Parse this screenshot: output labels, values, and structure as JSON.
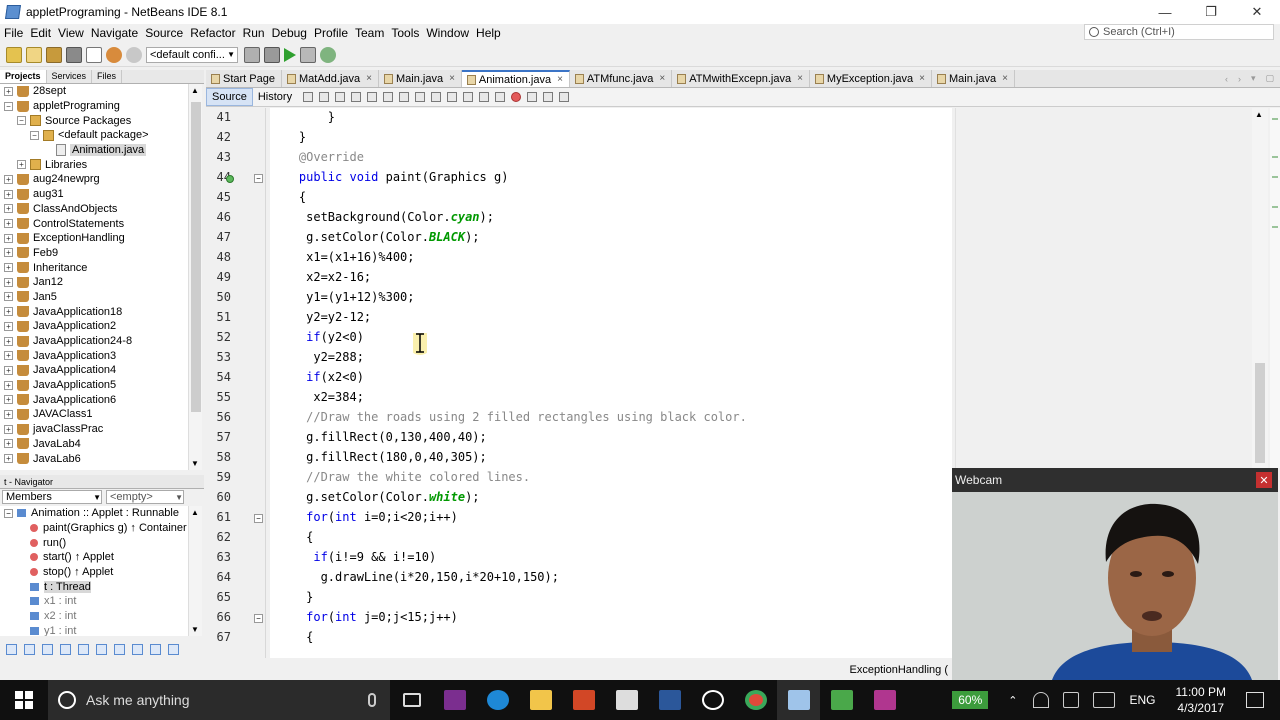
{
  "window": {
    "title": "appletPrograming - NetBeans IDE 8.1"
  },
  "menu": [
    "File",
    "Edit",
    "View",
    "Navigate",
    "Source",
    "Refactor",
    "Run",
    "Debug",
    "Profile",
    "Team",
    "Tools",
    "Window",
    "Help"
  ],
  "search": {
    "placeholder": "Search (Ctrl+I)"
  },
  "toolbar": {
    "config": "<default confi..."
  },
  "project_tabs": [
    "Projects",
    "Services",
    "Files"
  ],
  "projects": [
    {
      "label": "28sept",
      "level": 0,
      "type": "project"
    },
    {
      "label": "appletPrograming",
      "level": 0,
      "type": "project",
      "expanded": true
    },
    {
      "label": "Source Packages",
      "level": 1,
      "type": "pkgroot"
    },
    {
      "label": "<default package>",
      "level": 2,
      "type": "pkg"
    },
    {
      "label": "Animation.java",
      "level": 3,
      "type": "file",
      "selected": true
    },
    {
      "label": "Libraries",
      "level": 1,
      "type": "pkgroot"
    },
    {
      "label": "aug24newprg",
      "level": 0,
      "type": "project"
    },
    {
      "label": "aug31",
      "level": 0,
      "type": "project"
    },
    {
      "label": "ClassAndObjects",
      "level": 0,
      "type": "project"
    },
    {
      "label": "ControlStatements",
      "level": 0,
      "type": "project"
    },
    {
      "label": "ExceptionHandling",
      "level": 0,
      "type": "project"
    },
    {
      "label": "Feb9",
      "level": 0,
      "type": "project"
    },
    {
      "label": "Inheritance",
      "level": 0,
      "type": "project"
    },
    {
      "label": "Jan12",
      "level": 0,
      "type": "project"
    },
    {
      "label": "Jan5",
      "level": 0,
      "type": "project"
    },
    {
      "label": "JavaApplication18",
      "level": 0,
      "type": "project"
    },
    {
      "label": "JavaApplication2",
      "level": 0,
      "type": "project"
    },
    {
      "label": "JavaApplication24-8",
      "level": 0,
      "type": "project"
    },
    {
      "label": "JavaApplication3",
      "level": 0,
      "type": "project"
    },
    {
      "label": "JavaApplication4",
      "level": 0,
      "type": "project"
    },
    {
      "label": "JavaApplication5",
      "level": 0,
      "type": "project"
    },
    {
      "label": "JavaApplication6",
      "level": 0,
      "type": "project"
    },
    {
      "label": "JAVAClass1",
      "level": 0,
      "type": "project"
    },
    {
      "label": "javaClassPrac",
      "level": 0,
      "type": "project"
    },
    {
      "label": "JavaLab4",
      "level": 0,
      "type": "project"
    },
    {
      "label": "JavaLab6",
      "level": 0,
      "type": "project"
    }
  ],
  "navigator": {
    "title": "t - Navigator",
    "filter": "Members",
    "filter2": "<empty>",
    "items": [
      {
        "label": "Animation :: Applet : Runnable",
        "kind": "class"
      },
      {
        "label": "paint(Graphics g) ↑ Container",
        "kind": "method"
      },
      {
        "label": "run()",
        "kind": "method"
      },
      {
        "label": "start() ↑ Applet",
        "kind": "method"
      },
      {
        "label": "stop() ↑ Applet",
        "kind": "method"
      },
      {
        "label": "t : Thread",
        "kind": "field",
        "selected": true
      },
      {
        "label": "x1 : int",
        "kind": "field"
      },
      {
        "label": "x2 : int",
        "kind": "field"
      },
      {
        "label": "y1 : int",
        "kind": "field"
      }
    ]
  },
  "editor_tabs": [
    {
      "label": "Start Page",
      "active": false
    },
    {
      "label": "MatAdd.java",
      "active": false
    },
    {
      "label": "Main.java",
      "active": false
    },
    {
      "label": "Animation.java",
      "active": true
    },
    {
      "label": "ATMfunc.java",
      "active": false
    },
    {
      "label": "ATMwithExcepn.java",
      "active": false
    },
    {
      "label": "MyException.java",
      "active": false
    },
    {
      "label": "Main.java",
      "active": false
    }
  ],
  "editor_modes": [
    "Source",
    "History"
  ],
  "code_lines": [
    {
      "n": "41",
      "text": "        }"
    },
    {
      "n": "42",
      "text": "    }"
    },
    {
      "n": "43",
      "text": "    @Override"
    },
    {
      "n": "44",
      "text": "    public void paint(Graphics g)"
    },
    {
      "n": "45",
      "text": "    {"
    },
    {
      "n": "46",
      "text": "     setBackground(Color.cyan);"
    },
    {
      "n": "47",
      "text": "     g.setColor(Color.BLACK);"
    },
    {
      "n": "48",
      "text": "     x1=(x1+16)%400;"
    },
    {
      "n": "49",
      "text": "     x2=x2-16;"
    },
    {
      "n": "50",
      "text": "     y1=(y1+12)%300;"
    },
    {
      "n": "51",
      "text": "     y2=y2-12;"
    },
    {
      "n": "52",
      "text": "     if(y2<0)"
    },
    {
      "n": "53",
      "text": "      y2=288;"
    },
    {
      "n": "54",
      "text": "     if(x2<0)"
    },
    {
      "n": "55",
      "text": "      x2=384;"
    },
    {
      "n": "56",
      "text": "     //Draw the roads using 2 filled rectangles using black color."
    },
    {
      "n": "57",
      "text": "     g.fillRect(0,130,400,40);"
    },
    {
      "n": "58",
      "text": "     g.fillRect(180,0,40,305);"
    },
    {
      "n": "59",
      "text": "     //Draw the white colored lines."
    },
    {
      "n": "60",
      "text": "     g.setColor(Color.white);"
    },
    {
      "n": "61",
      "text": "     for(int i=0;i<20;i++)"
    },
    {
      "n": "62",
      "text": "     {"
    },
    {
      "n": "63",
      "text": "      if(i!=9 && i!=10)"
    },
    {
      "n": "64",
      "text": "       g.drawLine(i*20,150,i*20+10,150);"
    },
    {
      "n": "65",
      "text": "     }"
    },
    {
      "n": "66",
      "text": "     for(int j=0;j<15;j++)"
    },
    {
      "n": "67",
      "text": "     {"
    }
  ],
  "webcam": {
    "title": "Webcam"
  },
  "statusbar": {
    "text": "ExceptionHandling ("
  },
  "taskbar": {
    "search_placeholder": "Ask me anything",
    "battery": "60%",
    "lang": "ENG",
    "time": "11:00 PM",
    "date": "4/3/2017"
  },
  "colors": {
    "keyword": "#0000e6",
    "comment": "#888888",
    "constant": "#009900",
    "accent": "#3b74c6"
  }
}
